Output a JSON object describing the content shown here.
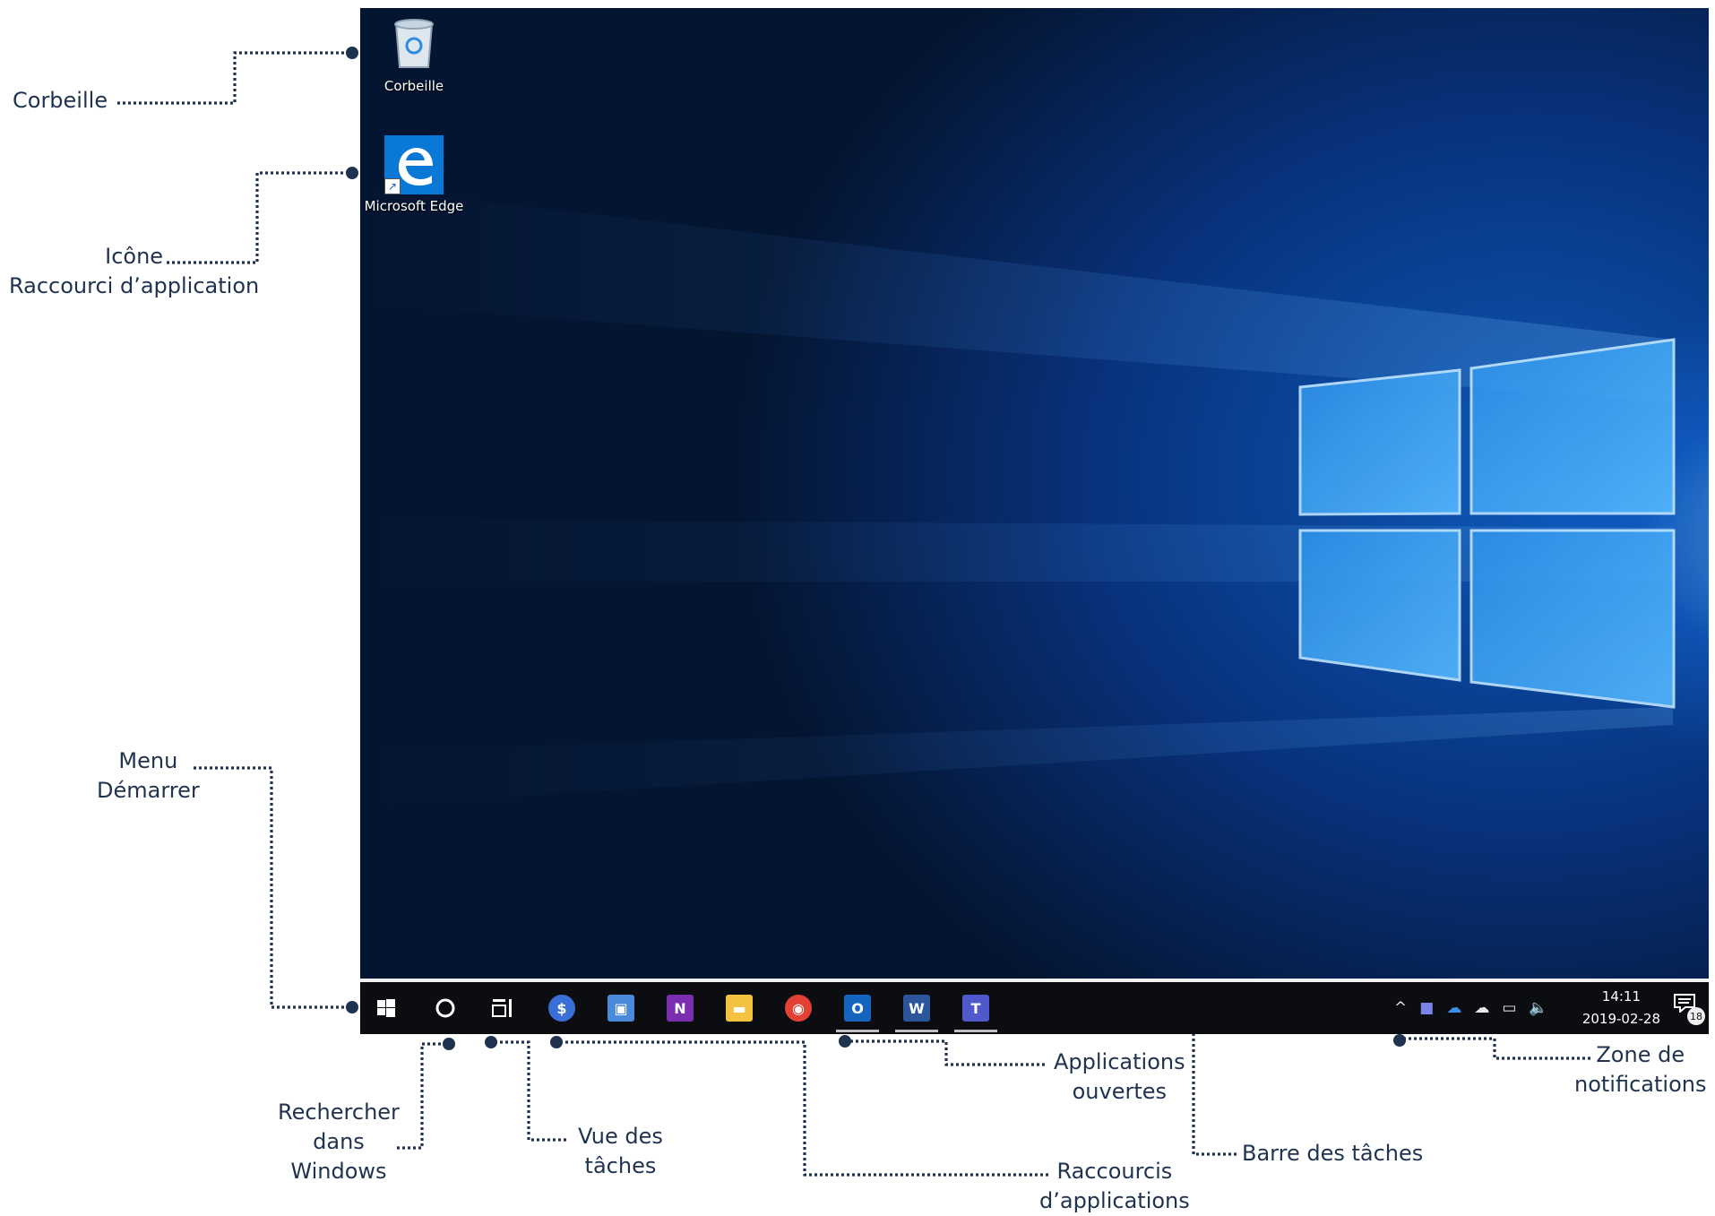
{
  "callouts": {
    "recycle_bin": "Corbeille",
    "shortcut_icon_line1": "Icône",
    "shortcut_icon_line2": "Raccourci d’application",
    "start_menu_line1": "Menu",
    "start_menu_line2": "Démarrer",
    "search_line1": "Rechercher",
    "search_line2": "dans",
    "search_line3": "Windows",
    "task_view_line1": "Vue des",
    "task_view_line2": "tâches",
    "open_apps_line1": "Applications",
    "open_apps_line2": "ouvertes",
    "app_shortcuts_line1": "Raccourcis",
    "app_shortcuts_line2": "d’applications",
    "taskbar": "Barre des tâches",
    "notification_area_line1": "Zone de",
    "notification_area_line2": "notifications"
  },
  "desktop": {
    "icons": [
      {
        "label": "Corbeille",
        "icon": "recycle-bin-icon"
      },
      {
        "label": "Microsoft Edge",
        "icon": "edge-icon"
      }
    ]
  },
  "taskbar": {
    "start_icon": "windows-logo-icon",
    "search_icon": "cortana-circle-icon",
    "task_view_icon": "task-view-icon",
    "pinned": [
      {
        "name": "app-sync",
        "glyph": "$",
        "color": "#3a6fd8"
      },
      {
        "name": "app-remote-desktop",
        "glyph": "▣",
        "color": "#4a8ad8"
      },
      {
        "name": "app-onenote",
        "glyph": "N",
        "color": "#7b2fb0"
      },
      {
        "name": "app-file-explorer",
        "glyph": "▬",
        "color": "#f3c340"
      },
      {
        "name": "app-chrome",
        "glyph": "◉",
        "color": "#e34133"
      }
    ],
    "open_apps": [
      {
        "name": "app-outlook",
        "glyph": "O",
        "color": "#1565c0"
      },
      {
        "name": "app-word",
        "glyph": "W",
        "color": "#2b579a"
      },
      {
        "name": "app-teams",
        "glyph": "T",
        "color": "#5059c9"
      }
    ],
    "tray": {
      "chevron": "^",
      "clock_time": "14:11",
      "clock_date": "2019-02-28",
      "notification_count": "18"
    }
  },
  "colors": {
    "callout_text": "#1f3350",
    "taskbar": "#0c0d10",
    "wallpaper_glow": "#3aa0ff"
  }
}
